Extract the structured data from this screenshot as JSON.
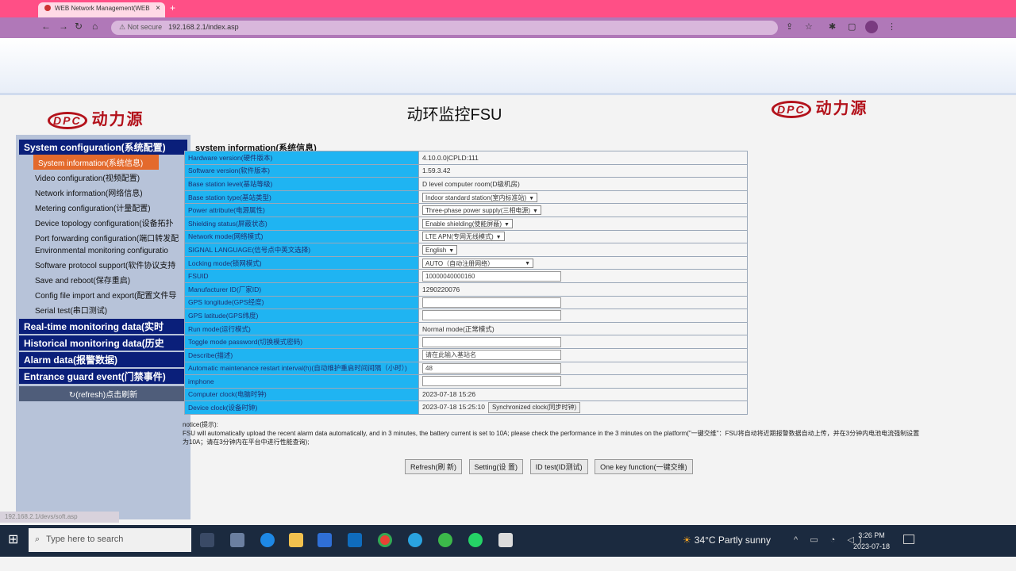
{
  "browser": {
    "tab_title": "WEB Network Management(WEB",
    "tab_close": "×",
    "new_tab": "+",
    "not_secure": "Not secure",
    "url": "192.168.2.1/index.asp",
    "status_url": "192.168.2.1/devs/soft.asp"
  },
  "header": {
    "logo_text": "动力源",
    "logo_mark": "DPC",
    "title": "动环监控FSU"
  },
  "sidebar": {
    "system_config": "System configuration(系统配置)",
    "items": [
      "System information(系统信息)",
      "Video configuration(视频配置)",
      "Network information(网络信息)",
      "Metering configuration(计量配置)",
      "Device topology configuration(设备拓扑",
      "Port forwarding configuration(端口转发配",
      "Environmental monitoring configuratio",
      "Software protocol support(软件协议支持",
      "Save and reboot(保存重启)",
      "Config file import and export(配置文件导",
      "Serial test(串口测试)"
    ],
    "realtime": "Real-time monitoring data(实时",
    "historical": "Historical monitoring data(历史",
    "alarm": "Alarm data(报警数据)",
    "entrance": "Entrance guard event(门禁事件)",
    "refresh": "(refresh)点击刷新"
  },
  "main": {
    "section_title": "system information(系统信息)",
    "rows": [
      {
        "label": "Hardware version(硬件版本)",
        "value": "4.10.0.0|CPLD:111"
      },
      {
        "label": "Software version(软件版本)",
        "value": "1.59.3.42"
      },
      {
        "label": "Base station level(基站等级)",
        "value": "D level computer room(D级机房)"
      },
      {
        "label": "Base station type(基站类型)",
        "value": "Indoor standard station(室内标准站)"
      },
      {
        "label": "Power attribute(电源属性)",
        "value": "Three-phase power supply(三相电源)"
      },
      {
        "label": "Shielding status(屏蔽状态)",
        "value": "Enable shielding(使能屏蔽)"
      },
      {
        "label": "Network mode(网络模式)",
        "value": "LTE APN(专网无线模式)"
      },
      {
        "label": "SIGNAL LANGUAGE(信号点中英文选择)",
        "value": "English"
      },
      {
        "label": "Locking mode(锁网模式)",
        "value": "AUTO（自动注册网络）"
      },
      {
        "label": "FSUID",
        "value": "10000040000160"
      },
      {
        "label": "Manufacturer ID(厂家ID)",
        "value": "1290220076"
      },
      {
        "label": "GPS longitude(GPS经度)",
        "value": ""
      },
      {
        "label": "GPS latitude(GPS纬度)",
        "value": ""
      },
      {
        "label": "Run mode(运行模式)",
        "value": "Normal mode(正常模式)"
      },
      {
        "label": "Toggle mode password(切换模式密码)",
        "value": ""
      },
      {
        "label": "Describe(描述)",
        "value": "请在此输入基站名"
      },
      {
        "label": "Automatic maintenance restart interval(h)(自动维护重启时间间隔（小时）)",
        "value": "48"
      },
      {
        "label": "imphone",
        "value": ""
      },
      {
        "label": "Computer clock(电脑时钟)",
        "value": "2023-07-18 15:26"
      },
      {
        "label": "Device clock(设备时钟)",
        "value": "2023-07-18 15:25:10"
      }
    ],
    "sync_clock": "Synchronized clock(同步时钟)",
    "notice_title": "notice(提示):",
    "notice_text": "FSU will automatically upload the recent alarm data automatically, and in 3 minutes, the battery current is set to 10A; please check the performance in the 3 minutes on the platform(\"一键交维\"：FSU将自动将近期报警数据自动上传，并在3分钟内电池电流强制设置为10A；请在3分钟内在平台中进行性能查询);",
    "buttons": {
      "refresh": "Refresh(刷 新)",
      "setting": "Setting(设 置)",
      "id_test": "ID test(ID测试)",
      "one_key": "One key function(一键交维)"
    }
  },
  "taskbar": {
    "search_placeholder": "Type here to search",
    "weather": "34°C  Partly sunny",
    "time": "3:26 PM",
    "date": "2023-07-18"
  }
}
